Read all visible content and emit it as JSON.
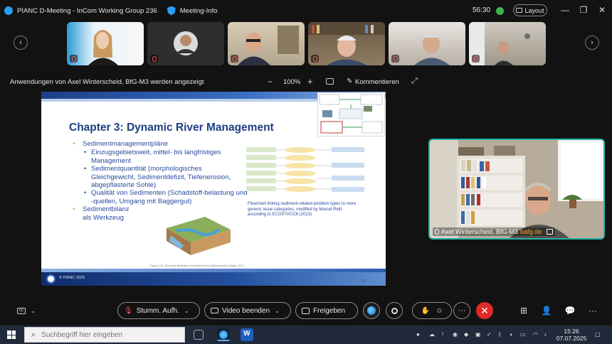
{
  "titlebar": {
    "meeting_title": "PIANC D-Meeting - InCom Working Group 236",
    "info_label": "Meeting-Info",
    "timer": "56:30",
    "layout_label": "Layout",
    "minimize": "—",
    "restore": "❐",
    "close": "✕"
  },
  "strip": {
    "prev": "‹",
    "next": "›"
  },
  "sharebar": {
    "share_text": "Anwendungen von Axel Winterscheid, BfG-M3 werden angezeigt",
    "zoom_minus": "−",
    "zoom_level": "100%",
    "zoom_plus": "+",
    "comment_label": "Kommentieren"
  },
  "slide": {
    "title": "Chapter 3: Dynamic River Management",
    "bullets": [
      {
        "text": "Sedimentmanagementpläne",
        "level": 1
      },
      {
        "text": "Einzugsgebietsweit, mittel- bis langfristiges Management",
        "level": 2
      },
      {
        "text": "Sedimentquantität (morphologisches Gleichgewicht, Sedimentdefizit, Tiefenerosion, abgepflasterte Sohle)",
        "level": 2
      },
      {
        "text": "Qualität von Sedimenten (Schadstoff-belastung und -quellen, Umgang mit Baggergut)",
        "level": 2
      },
      {
        "text": "Sedimentbilanz als Werkzeug",
        "level": 1
      }
    ],
    "caption": "Flowchart linking sediment-related problem types to more generic issue categories, modified by Marcel Reiß according to ECOSTAT/C6 (2023)",
    "footer": "© PIANC 2025",
    "page_number": "21"
  },
  "speaker": {
    "name": "Axel Winterscheid, BfG-M3",
    "domain": "bafg.de"
  },
  "controls": {
    "mute_label": "Stumm. Aufh.",
    "video_label": "Video beenden",
    "share_label": "Freigeben",
    "more": "···",
    "end": "✕"
  },
  "taskbar": {
    "search_placeholder": "Suchbegriff hier eingeben",
    "time": "15:26",
    "date": "07.07.2025"
  }
}
